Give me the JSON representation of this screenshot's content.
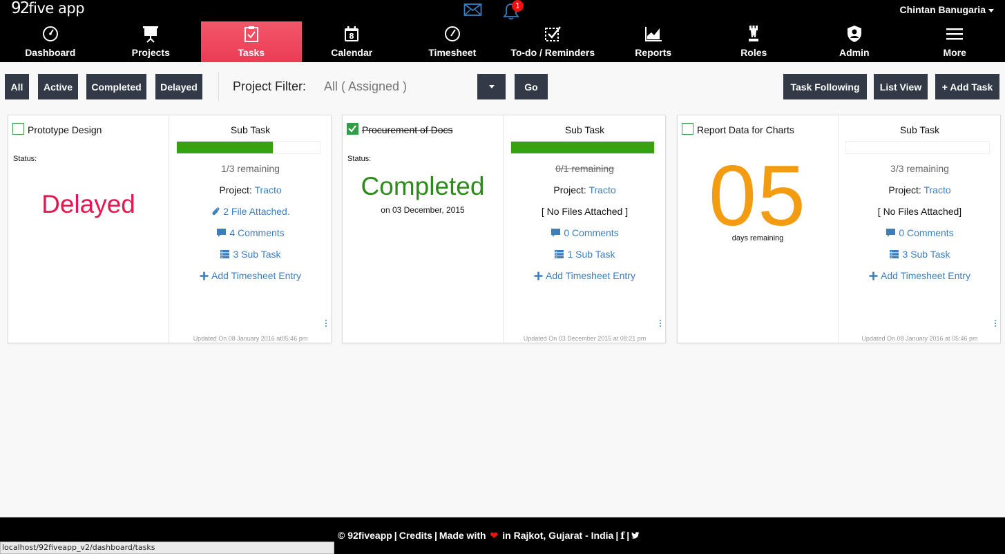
{
  "header": {
    "logo_num": "92",
    "logo_text": "five app",
    "notification_count": "1",
    "user_name": "Chintan Banugaria"
  },
  "nav": [
    {
      "label": "Dashboard",
      "icon": "dashboard-gauge-icon"
    },
    {
      "label": "Projects",
      "icon": "presentation-board-icon"
    },
    {
      "label": "Tasks",
      "icon": "clipboard-check-icon",
      "active": true
    },
    {
      "label": "Calendar",
      "icon": "calendar-icon",
      "calendar_day": "8"
    },
    {
      "label": "Timesheet",
      "icon": "clock-icon"
    },
    {
      "label": "To-do / Reminders",
      "icon": "checklist-icon"
    },
    {
      "label": "Reports",
      "icon": "area-chart-icon"
    },
    {
      "label": "Roles",
      "icon": "chess-piece-icon"
    },
    {
      "label": "Admin",
      "icon": "shield-user-icon"
    },
    {
      "label": "More",
      "icon": "hamburger-icon"
    }
  ],
  "filters": {
    "all": "All",
    "active": "Active",
    "completed": "Completed",
    "delayed": "Delayed",
    "project_filter_label": "Project Filter:",
    "project_filter_value": "All ( Assigned )",
    "go": "Go",
    "task_following": "Task Following",
    "list_view": "List View",
    "add_task": "+ Add Task"
  },
  "tasks": [
    {
      "title": "Prototype Design",
      "checked": false,
      "status_label": "Status:",
      "status_text": "Delayed",
      "subtask_heading": "Sub Task",
      "progress": 0.67,
      "remaining": "1/3 remaining",
      "project_label": "Project:",
      "project_name": "Tracto",
      "files": "2 File Attached.",
      "comments": "4 Comments",
      "subtasks": "3 Sub Task",
      "add_timesheet": "Add Timesheet Entry",
      "updated": "Updated On 08 January 2016 at05:46 pm"
    },
    {
      "title": "Procurement of Docs",
      "checked": true,
      "status_label": "Status:",
      "status_text": "Completed",
      "status_date": "on 03 December, 2015",
      "subtask_heading": "Sub Task",
      "progress": 1.0,
      "remaining": "0/1 remaining",
      "project_label": "Project:",
      "project_name": "Tracto",
      "files": "[ No Files Attached ]",
      "comments": "0 Comments",
      "subtasks": "1 Sub Task",
      "add_timesheet": "Add Timesheet Entry",
      "updated": "Updated On 03 December 2015 at 08:21 pm"
    },
    {
      "title": "Report Data for Charts",
      "checked": false,
      "days_number": "05",
      "days_text": "days remaining",
      "subtask_heading": "Sub Task",
      "progress": 0.0,
      "remaining": "3/3 remaining",
      "project_label": "Project:",
      "project_name": "Tracto",
      "files": "[ No Files Attached]",
      "comments": "0 Comments",
      "subtasks": "3 Sub Task",
      "add_timesheet": "Add Timesheet Entry",
      "updated": "Updated On 08 January 2016 at 05:46 pm"
    }
  ],
  "footer": {
    "copyright": "© 92fiveapp",
    "credits": "Credits",
    "made_with": "Made with",
    "location": "in Rajkot, Gujarat - India"
  },
  "status_url": "localhost/92fiveapp_v2/dashboard/tasks",
  "colors": {
    "active_tab": "#ec3c55",
    "button_dark": "#323a47",
    "progress_green": "#39a010",
    "delayed": "#e8154f",
    "completed": "#2f8a1c",
    "days": "#f39c12",
    "link": "#3a7ec0"
  }
}
